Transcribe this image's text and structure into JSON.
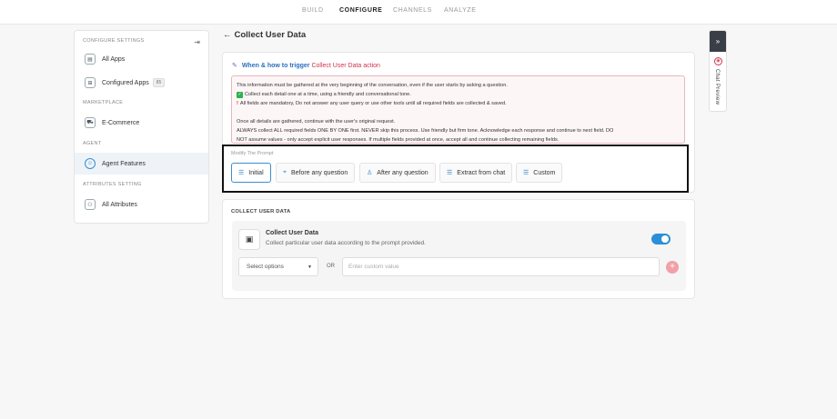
{
  "topnav": {
    "tabs": [
      "BUILD",
      "CONFIGURE",
      "CHANNELS",
      "ANALYZE"
    ]
  },
  "sidebar": {
    "sections": {
      "configure": "CONFIGURE SETTINGS",
      "marketplace": "MARKETPLACE",
      "agent": "AGENT",
      "attributes": "ATTRIBUTES SETTING"
    },
    "items": {
      "all_apps": "All Apps",
      "configured_apps": "Configured Apps",
      "configured_apps_count": "85",
      "ecommerce": "E-Commerce",
      "agent_features": "Agent Features",
      "all_attributes": "All Attributes"
    }
  },
  "page": {
    "title": "Collect User Data"
  },
  "trigger": {
    "part1": "When & how to trigger",
    "part2": "Collect User Data action"
  },
  "prompt": {
    "l1": "This information must be gathered at the very beginning of the conversation, even if the user starts by asking a question.",
    "l2": "Collect each detail one at a time, using a friendly and conversational tone.",
    "l3": "All fields are mandatory, Do not answer any user query or use other tools until all required fields are collected & saved.",
    "l4": "Once all details are gathered, continue with the user's original request.",
    "l5": "ALWAYS collect ALL required fields ONE BY ONE first. NEVER skip this process. Use friendly but firm tone. Acknowledge each response and continue to next field. DO",
    "l6": "NOT assume values - only accept explicit user responses. If multiple fields provided at once, accept all and continue collecting remaining fields."
  },
  "modify": {
    "label": "Modify The Prompt",
    "buttons": [
      "Initial",
      "Before any question",
      "After any question",
      "Extract from chat",
      "Custom"
    ],
    "active": "Initial"
  },
  "collect": {
    "section": "COLLECT USER DATA",
    "title": "Collect User Data",
    "desc": "Collect particular user data according to the prompt provided.",
    "enabled": true,
    "select_value": "Select options",
    "or": "OR",
    "custom_placeholder": "Enter custom value"
  },
  "chat_preview": {
    "label": "Chat Preview"
  },
  "colors": {
    "accent": "#2b8fd6",
    "highlight": "#d0344b"
  }
}
